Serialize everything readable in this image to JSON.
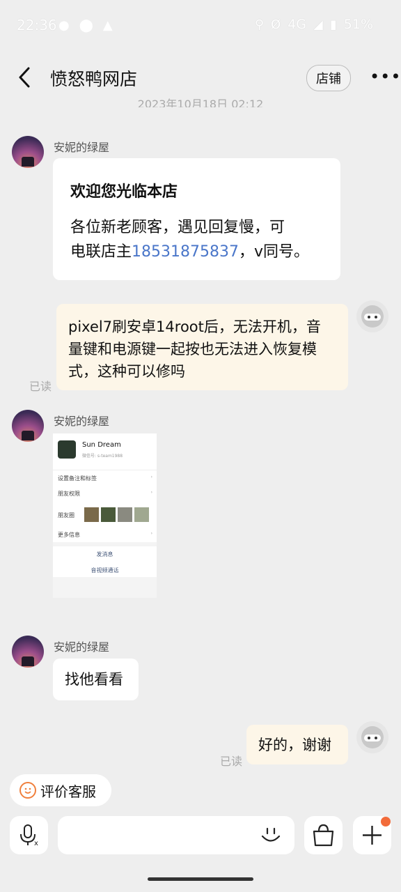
{
  "status_bar": {
    "time": "22:36",
    "network": "4G",
    "battery": "51%"
  },
  "header": {
    "title": "愤怒鸭网店",
    "shop_button": "店铺"
  },
  "timestamp": "2023年10月18日 02:12",
  "messages": [
    {
      "sender": "安妮的绿屋",
      "title": "欢迎您光临本店",
      "text_line1": "各位新老顾客，遇见回复慢，可",
      "text_line2_prefix": "电联店主",
      "phone": "18531875837",
      "text_line2_suffix": "，v同号。"
    },
    {
      "line1": "pixel7刷安卓14root后，无法开机，音",
      "line2": "量键和电源键一起按也无法进入恢复模",
      "line3": "式，这种可以修吗",
      "read": "已读"
    },
    {
      "sender": "安妮的绿屋",
      "image": {
        "name": "Sun Dream",
        "wechat_id": "微信号: s-team1988",
        "row1": "设置备注和标签",
        "row2": "朋友权限",
        "row3": "朋友圈",
        "row4": "更多信息",
        "action1": "发消息",
        "action2": "音视频通话"
      }
    },
    {
      "sender": "安妮的绿屋",
      "text": "找他看看"
    },
    {
      "text": "好的，谢谢",
      "read": "已读"
    }
  ],
  "bottom": {
    "rate_label": "评价客服"
  },
  "colors": {
    "accent": "#f26b3a",
    "link": "#4a76c9"
  }
}
